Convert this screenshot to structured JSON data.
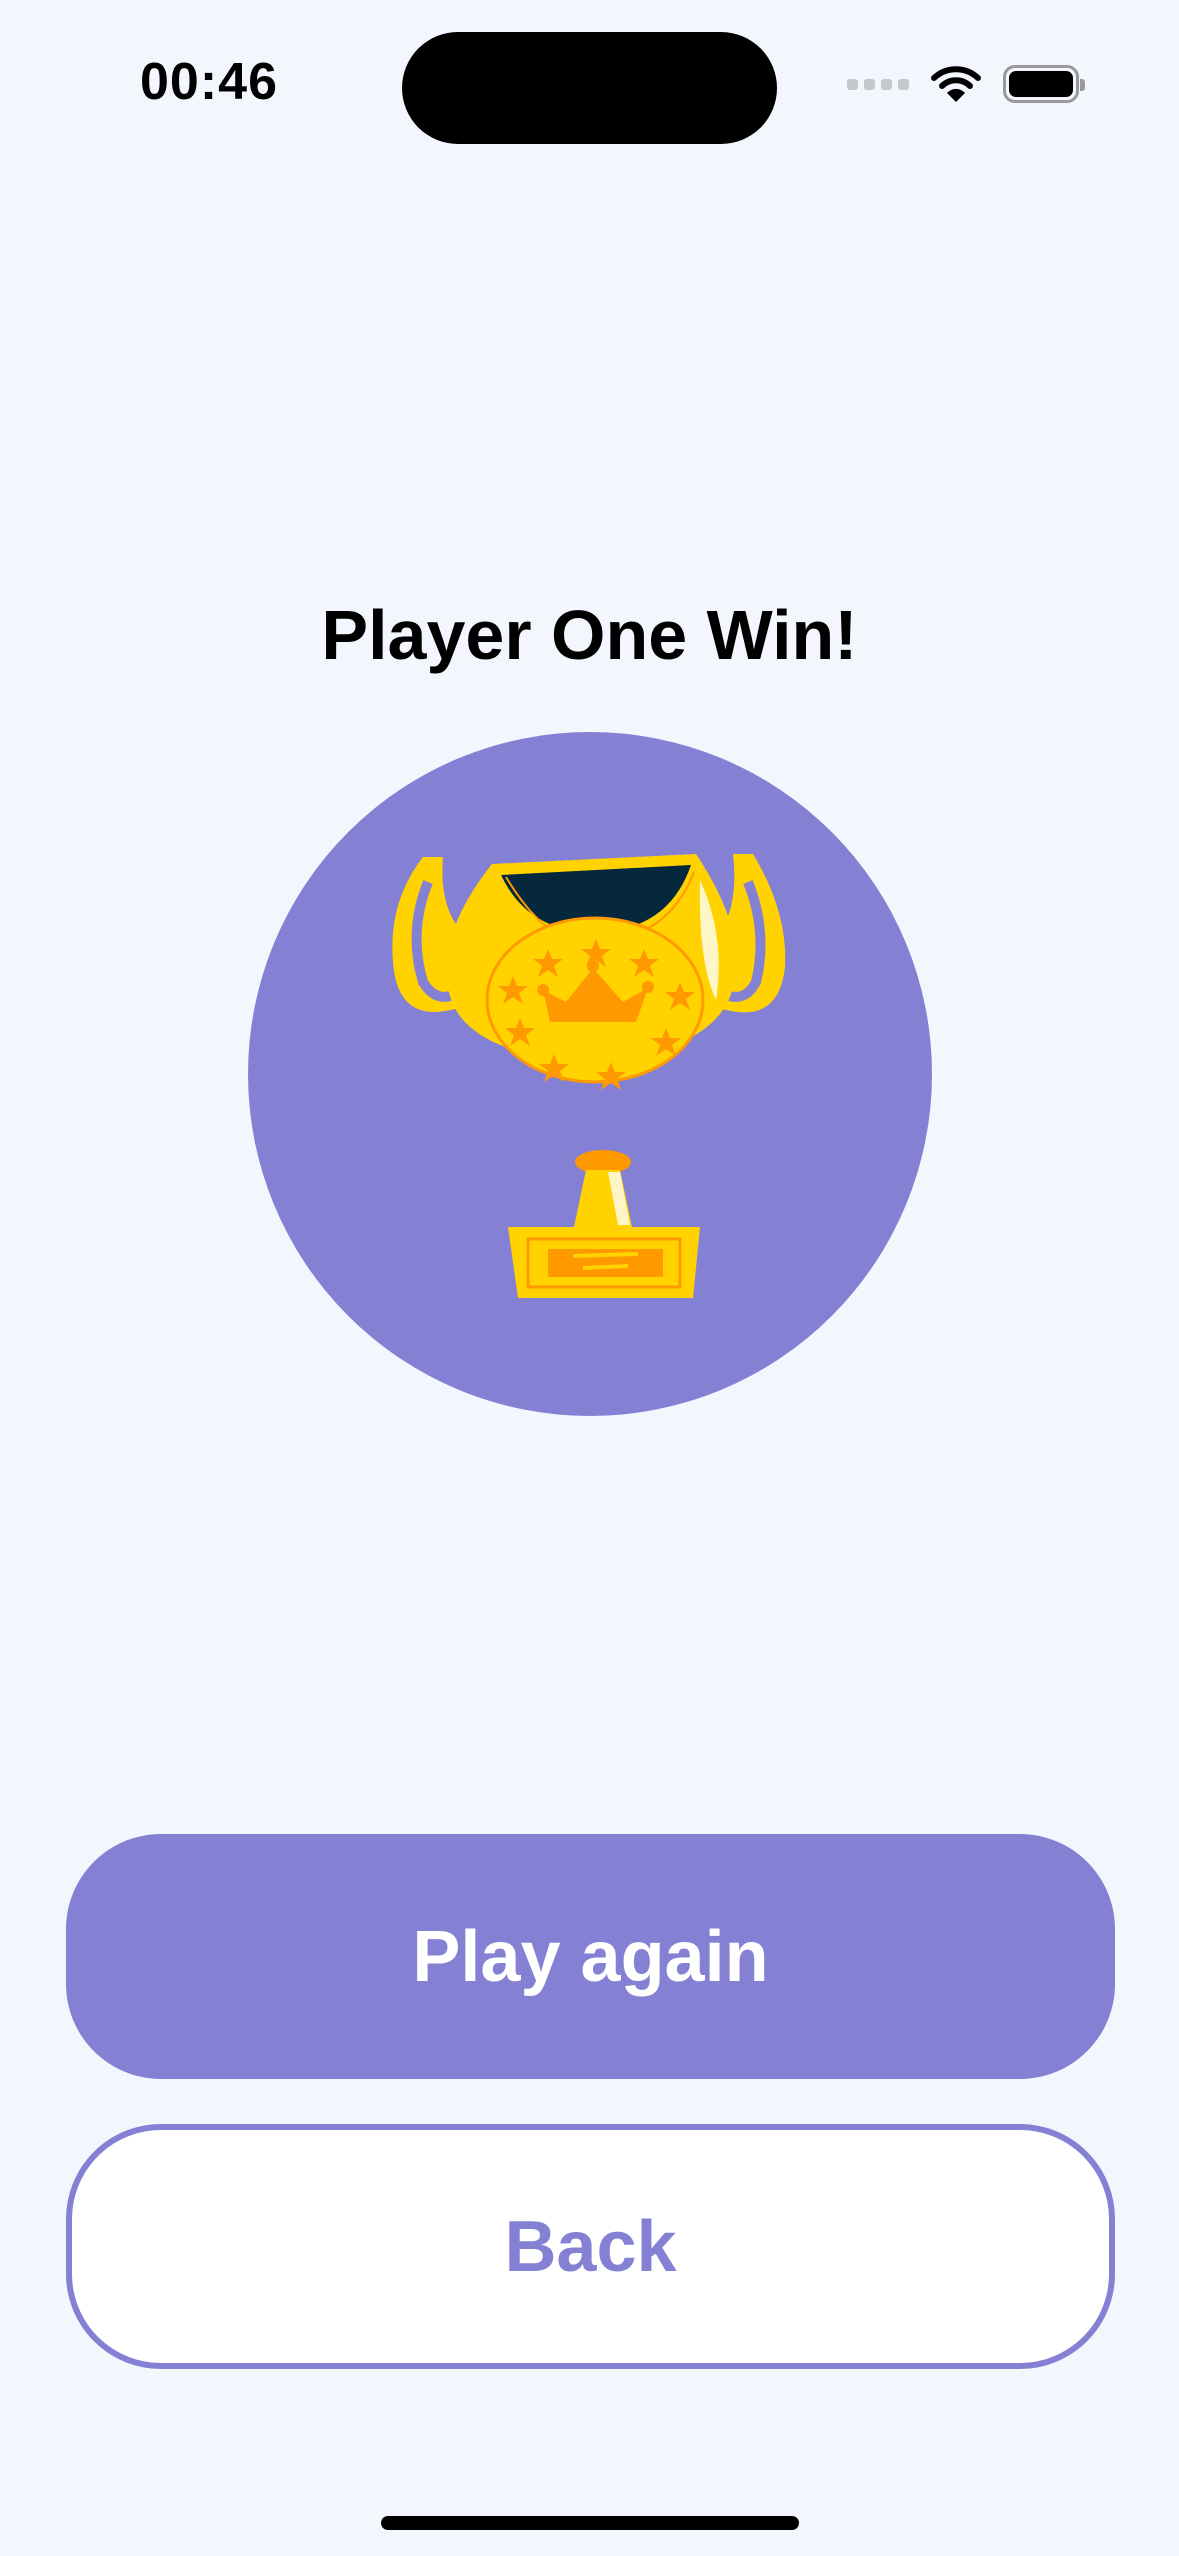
{
  "status_bar": {
    "time": "00:46",
    "wifi_icon": "wifi-icon",
    "battery_icon": "battery-icon",
    "cellular_icon": "cellular-signal-icon"
  },
  "result": {
    "title": "Player One Win!",
    "image": "trophy-icon"
  },
  "actions": {
    "play_again_label": "Play again",
    "back_label": "Back"
  },
  "colors": {
    "accent": "#8481d4",
    "background": "#f3f7fd",
    "trophy_gold": "#ffd200",
    "trophy_orange": "#ff9900",
    "trophy_dark": "#06283d"
  }
}
